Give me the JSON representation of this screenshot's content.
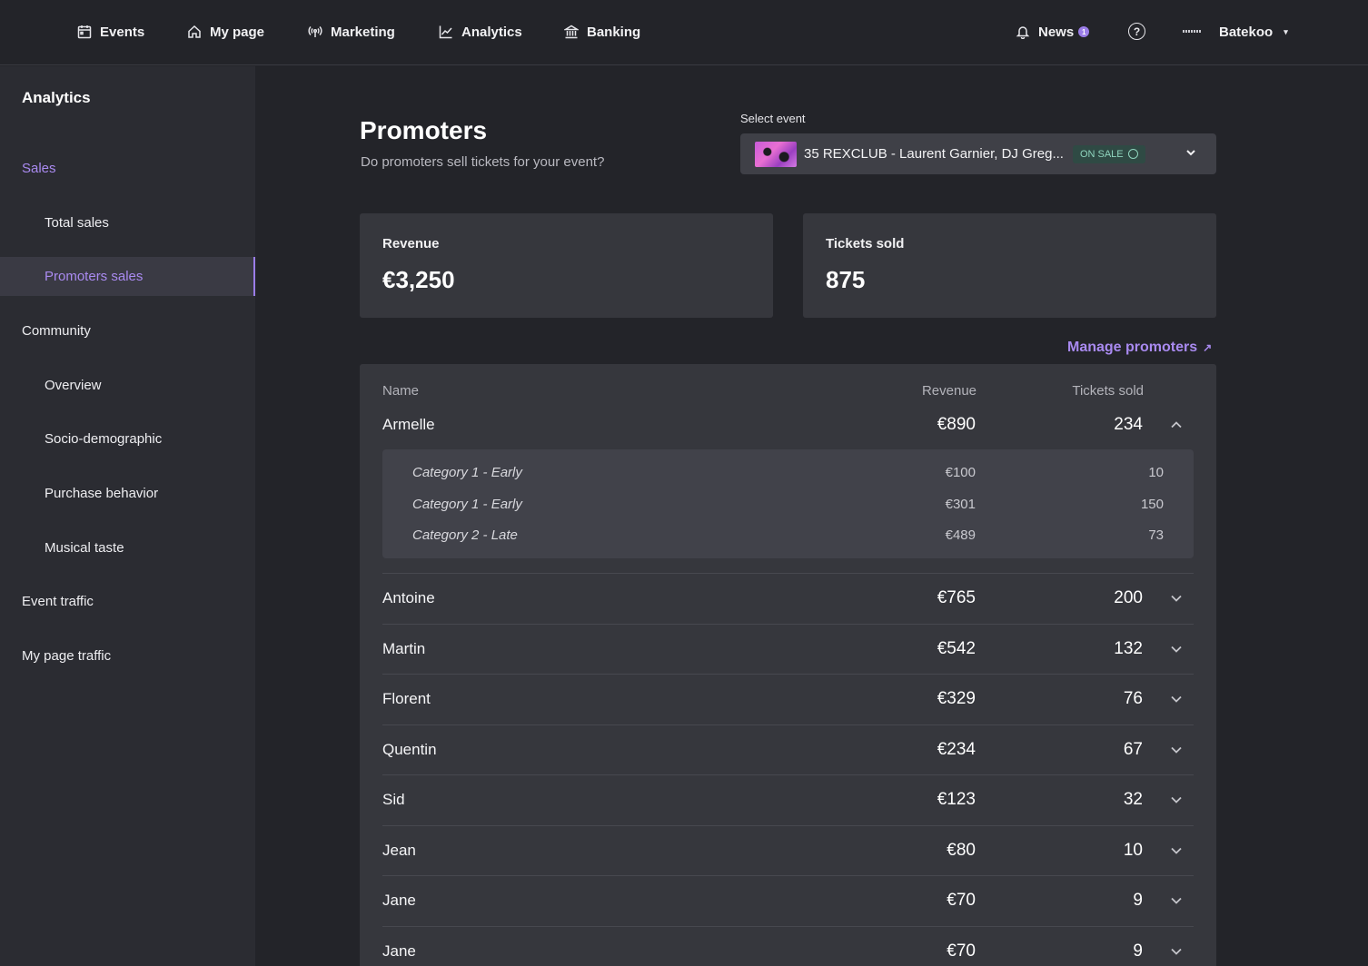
{
  "nav": {
    "items": [
      {
        "label": "Events",
        "icon": "calendar-icon"
      },
      {
        "label": "My page",
        "icon": "home-icon"
      },
      {
        "label": "Marketing",
        "icon": "broadcast-icon"
      },
      {
        "label": "Analytics",
        "icon": "chart-line-icon"
      },
      {
        "label": "Banking",
        "icon": "bank-icon"
      }
    ],
    "news_label": "News",
    "news_count": "1",
    "help_glyph": "?",
    "user_name": "Batekoo"
  },
  "sidebar": {
    "title": "Analytics",
    "items": [
      {
        "label": "Sales"
      },
      {
        "label": "Total sales"
      },
      {
        "label": "Promoters sales"
      },
      {
        "label": "Community"
      },
      {
        "label": "Overview"
      },
      {
        "label": "Socio-demographic"
      },
      {
        "label": "Purchase behavior"
      },
      {
        "label": "Musical taste"
      },
      {
        "label": "Event traffic"
      },
      {
        "label": "My page traffic"
      }
    ]
  },
  "header": {
    "title": "Promoters",
    "subtitle": "Do promoters sell tickets for your event?"
  },
  "event_select": {
    "label": "Select event",
    "value": "35 REXCLUB - Laurent Garnier, DJ Greg...",
    "status": "ON SALE"
  },
  "stats": {
    "revenue_label": "Revenue",
    "revenue_value": "€3,250",
    "tickets_label": "Tickets sold",
    "tickets_value": "875"
  },
  "manage_link": "Manage promoters",
  "table": {
    "headers": {
      "name": "Name",
      "revenue": "Revenue",
      "tickets": "Tickets sold"
    },
    "rows": [
      {
        "name": "Armelle",
        "revenue": "€890",
        "tickets": "234",
        "expanded": true
      },
      {
        "name": "Antoine",
        "revenue": "€765",
        "tickets": "200"
      },
      {
        "name": "Martin",
        "revenue": "€542",
        "tickets": "132"
      },
      {
        "name": "Florent",
        "revenue": "€329",
        "tickets": "76"
      },
      {
        "name": "Quentin",
        "revenue": "€234",
        "tickets": "67"
      },
      {
        "name": "Sid",
        "revenue": "€123",
        "tickets": "32"
      },
      {
        "name": "Jean",
        "revenue": "€80",
        "tickets": "10"
      },
      {
        "name": "Jane",
        "revenue": "€70",
        "tickets": "9"
      },
      {
        "name": "Jane",
        "revenue": "€70",
        "tickets": "9"
      }
    ],
    "details": [
      {
        "category": "Category 1 - Early",
        "revenue": "€100",
        "tickets": "10"
      },
      {
        "category": "Category 1 - Early",
        "revenue": "€301",
        "tickets": "150"
      },
      {
        "category": "Category 2 - Late",
        "revenue": "€489",
        "tickets": "73"
      }
    ]
  },
  "colors": {
    "accent": "#a98af0",
    "background": "#232429",
    "sidebar": "#2b2c32",
    "card": "#36373d",
    "onsale_bg": "#2f4a44",
    "onsale_text": "#8fd4bd"
  }
}
